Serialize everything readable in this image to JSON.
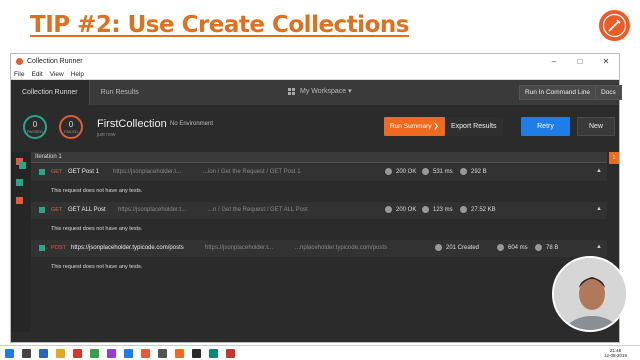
{
  "slide": {
    "title": "TIP #2: Use Create Collections"
  },
  "window": {
    "title": "Collection Runner",
    "controls": [
      "–",
      "□",
      "✕"
    ],
    "menu": [
      "File",
      "Edit",
      "View",
      "Help"
    ]
  },
  "navbar": {
    "tab_runner": "Collection Runner",
    "tab_results": "Run Results",
    "workspace": "My Workspace ▾",
    "btn_cli": "Run In Command Line",
    "btn_docs": "Docs"
  },
  "summary": {
    "passed_count": "0",
    "passed_label": "PASSED",
    "failed_count": "0",
    "failed_label": "FAILED",
    "collection_name": "FirstCollection",
    "environment": "No Environment",
    "sub": "just now",
    "btn_summary": "Run Summary ❯",
    "btn_export": "Export Results",
    "btn_retry": "Retry",
    "btn_new": "New"
  },
  "iteration": {
    "label": "Iteration 1",
    "badge": "1"
  },
  "requests": [
    {
      "method": "GET",
      "name": "GET Post 1",
      "url": "https://jsonplaceholder.t...",
      "path": "...ion / Get the Request / GET Post 1",
      "status": "200 OK",
      "time": "531 ms",
      "size": "292 B",
      "tests": "This request does not have any tests."
    },
    {
      "method": "GET",
      "name": "GET ALL Post",
      "url": "https://jsonplaceholder.t...",
      "path": "...n / Get the Request / GET ALL Post",
      "status": "200 OK",
      "time": "123 ms",
      "size": "27.52 KB",
      "tests": "This request does not have any tests."
    },
    {
      "method": "POST",
      "name": "https://jsonplaceholder.typicode.com/posts",
      "url": "https://jsonplaceholder.t...",
      "path": "...nplaceholder.typicode.com/posts",
      "status": "201 Created",
      "time": "604 ms",
      "size": "78 B",
      "tests": "This request does not have any tests."
    }
  ],
  "taskbar": {
    "time": "21:48",
    "date": "12-08-2019"
  },
  "colors": {
    "accent": "#ef6a1f",
    "retry": "#1e7de6",
    "pass": "#2aa58a",
    "fail": "#e25d3a"
  }
}
